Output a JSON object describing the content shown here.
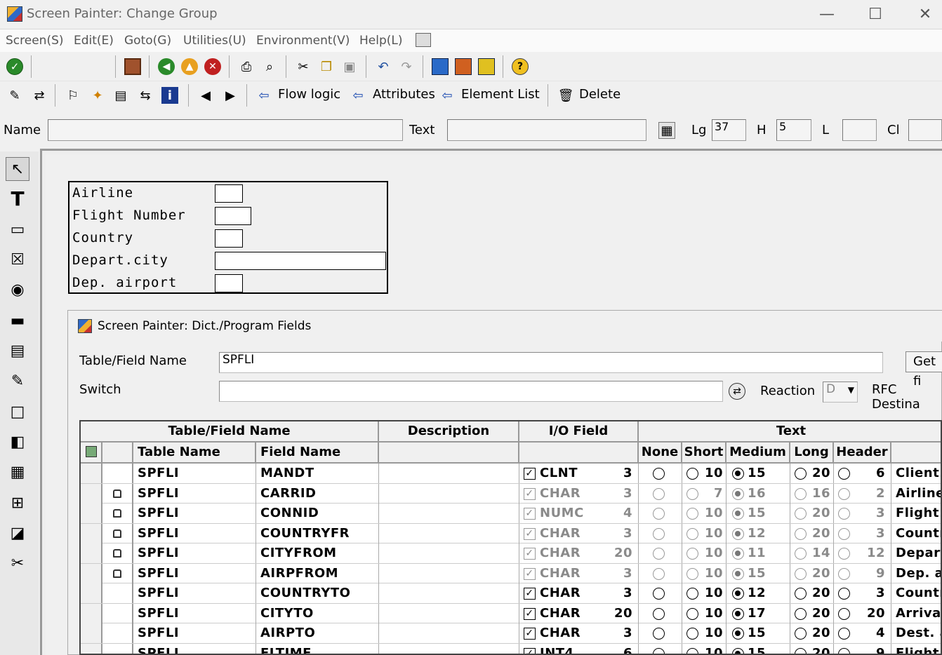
{
  "window": {
    "title": "Screen Painter:  Change Group",
    "minimize": "—",
    "maximize": "☐",
    "close": "✕"
  },
  "menu": [
    "Screen(S)",
    "Edit(E)",
    "Goto(G)",
    "Utilities(U)",
    "Environment(V)",
    "Help(L)"
  ],
  "toolbar2": {
    "flow_logic": "Flow logic",
    "attributes": "Attributes",
    "element_list": "Element List",
    "delete": "Delete"
  },
  "props": {
    "name_label": "Name",
    "name_value": "",
    "text_label": "Text",
    "text_value": "",
    "lg_label": "Lg",
    "lg_value": "37",
    "h_label": "H",
    "h_value": "5",
    "l_label": "L",
    "l_value": "",
    "cl_label": "Cl",
    "cl_value": ""
  },
  "screen_fields": [
    {
      "label": "Airline"
    },
    {
      "label": "Flight Number"
    },
    {
      "label": "Country"
    },
    {
      "label": "Depart.city"
    },
    {
      "label": "Dep. airport"
    }
  ],
  "dialog": {
    "title": "Screen Painter: Dict./Program Fields",
    "table_field_label": "Table/Field Name",
    "table_field_value": "SPFLI",
    "get_button": "Get fi",
    "switch_label": "Switch",
    "switch_value": "",
    "reaction_label": "Reaction",
    "reaction_value": "D",
    "rfc_label": "RFC Destina"
  },
  "grid": {
    "group_headers": {
      "table_field": "Table/Field Name",
      "description": "Description",
      "io_field": "I/O Field",
      "text": "Text"
    },
    "sub_headers": {
      "table_name": "Table Name",
      "field_name": "Field Name",
      "none": "None",
      "short": "Short",
      "medium": "Medium",
      "long": "Long",
      "header": "Header"
    },
    "rows": [
      {
        "locked": false,
        "dim": false,
        "table": "SPFLI",
        "field": "MANDT",
        "type": "CLNT",
        "len": "3",
        "short": "10",
        "medium": "15",
        "long": "20",
        "header": "6",
        "sel": "medium",
        "text": "Client"
      },
      {
        "locked": true,
        "dim": true,
        "table": "SPFLI",
        "field": "CARRID",
        "type": "CHAR",
        "len": "3",
        "short": "7",
        "medium": "16",
        "long": "16",
        "header": "2",
        "sel": "medium",
        "text": "Airline"
      },
      {
        "locked": true,
        "dim": true,
        "table": "SPFLI",
        "field": "CONNID",
        "type": "NUMC",
        "len": "4",
        "short": "10",
        "medium": "15",
        "long": "20",
        "header": "3",
        "sel": "medium",
        "text": "Flight N"
      },
      {
        "locked": true,
        "dim": true,
        "table": "SPFLI",
        "field": "COUNTRYFR",
        "type": "CHAR",
        "len": "3",
        "short": "10",
        "medium": "12",
        "long": "20",
        "header": "3",
        "sel": "medium",
        "text": "Country"
      },
      {
        "locked": true,
        "dim": true,
        "table": "SPFLI",
        "field": "CITYFROM",
        "type": "CHAR",
        "len": "20",
        "short": "10",
        "medium": "11",
        "long": "14",
        "header": "12",
        "sel": "medium",
        "text": "Depart."
      },
      {
        "locked": true,
        "dim": true,
        "table": "SPFLI",
        "field": "AIRPFROM",
        "type": "CHAR",
        "len": "3",
        "short": "10",
        "medium": "15",
        "long": "20",
        "header": "9",
        "sel": "medium",
        "text": "Dep. ai"
      },
      {
        "locked": false,
        "dim": false,
        "table": "SPFLI",
        "field": "COUNTRYTO",
        "type": "CHAR",
        "len": "3",
        "short": "10",
        "medium": "12",
        "long": "20",
        "header": "3",
        "sel": "medium",
        "text": "Country"
      },
      {
        "locked": false,
        "dim": false,
        "table": "SPFLI",
        "field": "CITYTO",
        "type": "CHAR",
        "len": "20",
        "short": "10",
        "medium": "17",
        "long": "20",
        "header": "20",
        "sel": "medium",
        "text": "Arrival"
      },
      {
        "locked": false,
        "dim": false,
        "table": "SPFLI",
        "field": "AIRPTO",
        "type": "CHAR",
        "len": "3",
        "short": "10",
        "medium": "15",
        "long": "20",
        "header": "4",
        "sel": "medium",
        "text": "Dest. a"
      },
      {
        "locked": false,
        "dim": false,
        "table": "SPFLI",
        "field": "FLTIME",
        "type": "INT4",
        "len": "6",
        "short": "10",
        "medium": "15",
        "long": "20",
        "header": "9",
        "sel": "medium",
        "text": "Flight t"
      }
    ]
  }
}
